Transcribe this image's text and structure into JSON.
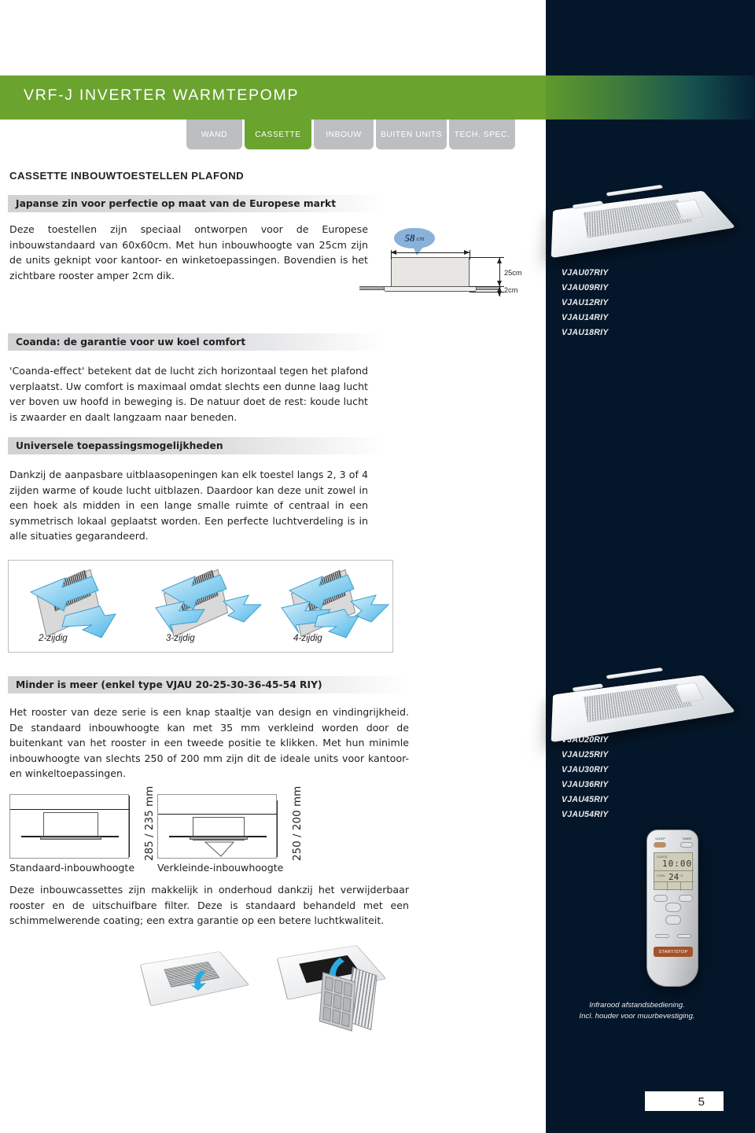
{
  "header": {
    "title": "VRF-J INVERTER WARMTEPOMP",
    "brand_green": "#6aa32e",
    "panel_dark": "#041629",
    "tabs": [
      {
        "label": "WAND",
        "active": false
      },
      {
        "label": "CASSETTE",
        "active": true
      },
      {
        "label": "INBOUW",
        "active": false
      },
      {
        "label": "BUITEN UNITS",
        "active": false
      },
      {
        "label": "TECH. SPEC.",
        "active": false
      }
    ]
  },
  "main": {
    "section_title": "CASSETTE INBOUWTOESTELLEN PLAFOND",
    "blocks": [
      {
        "heading": "Japanse zin voor perfectie op maat van de Europese markt",
        "body": "Deze toestellen zijn speciaal ontworpen voor de Europese inbouwstandaard van 60x60cm. Met hun inbouwhoogte van 25cm zijn de units geknipt voor kantoor- en winketoepassingen. Bovendien is het zichtbare rooster amper 2cm dik."
      },
      {
        "heading": "Coanda: de garantie voor uw koel comfort",
        "body": "'Coanda-effect' betekent dat de lucht zich horizontaal tegen het plafond verplaatst. Uw comfort is maximaal omdat slechts een dunne laag lucht ver boven uw hoofd in beweging is. De natuur doet de rest: koude lucht is zwaarder en daalt langzaam naar beneden."
      },
      {
        "heading": "Universele toepassingsmogelijkheden",
        "body": "Dankzij de aanpasbare uitblaasopeningen kan elk toestel langs 2, 3 of 4 zijden warme of koude lucht uitblazen. Daardoor kan deze unit zowel in een hoek als midden in een lange smalle ruimte of centraal in een symmetrisch lokaal geplaatst worden. Een perfecte luchtverdeling is in alle situaties gegarandeerd."
      },
      {
        "heading": "Minder is meer (enkel type VJAU 20-25-30-36-45-54 RIY)",
        "body": "Het rooster van deze serie is een knap staaltje van design en vindingrijkheid. De standaard inbouwhoogte kan met 35 mm verkleind worden door de buitenkant van het rooster in een tweede positie te klikken. Met hun minimle inbouwhoogte van slechts 250 of 200 mm zijn dit de ideale units voor kantoor- en winkeltoepassingen."
      }
    ],
    "maintenance_text": "Deze inbouwcassettes zijn makkelijk in onderhoud dankzij het verwijderbaar rooster en de uitschuifbare filter. Deze is standaard behandeld met een schimmelwerende coating; een extra garantie op een betere luchtkwaliteit."
  },
  "dimension_figure": {
    "bubble_value": "58",
    "bubble_unit": "cm",
    "height_label": "25cm",
    "grille_label": "2cm"
  },
  "airflow_figure": {
    "items": [
      {
        "label": "2-zijdig"
      },
      {
        "label": "3-zijdig"
      },
      {
        "label": "4-zijdig"
      }
    ]
  },
  "height_figures": [
    {
      "caption": "Standaard-inbouwhoogte",
      "dimension": "285 / 235 mm"
    },
    {
      "caption": "Verkleinde-inbouwhoogte",
      "dimension": "250 / 200 mm"
    }
  ],
  "sidebar": {
    "model_list_top": "VJAU07RIY\nVJAU09RIY\nVJAU12RIY\nVJAU14RIY\nVJAU18RIY",
    "model_list_bottom": "VJAU20RIY\nVJAU25RIY\nVJAU30RIY\nVJAU36RIY\nVJAU45RIY\nVJAU54RIY",
    "remote_caption": "Infrarood afstandsbediening.\nIncl. houder voor muurbevestiging.",
    "remote": {
      "sleep_label": "SLEEP",
      "timer_label": "TIMER",
      "clock_label": "CLOCK",
      "clock_value": "10:00",
      "mode_label": "COOL",
      "temp_value": "24",
      "temp_unit": "°C",
      "start_stop_label": "START/STOP"
    }
  },
  "page_number": "5"
}
